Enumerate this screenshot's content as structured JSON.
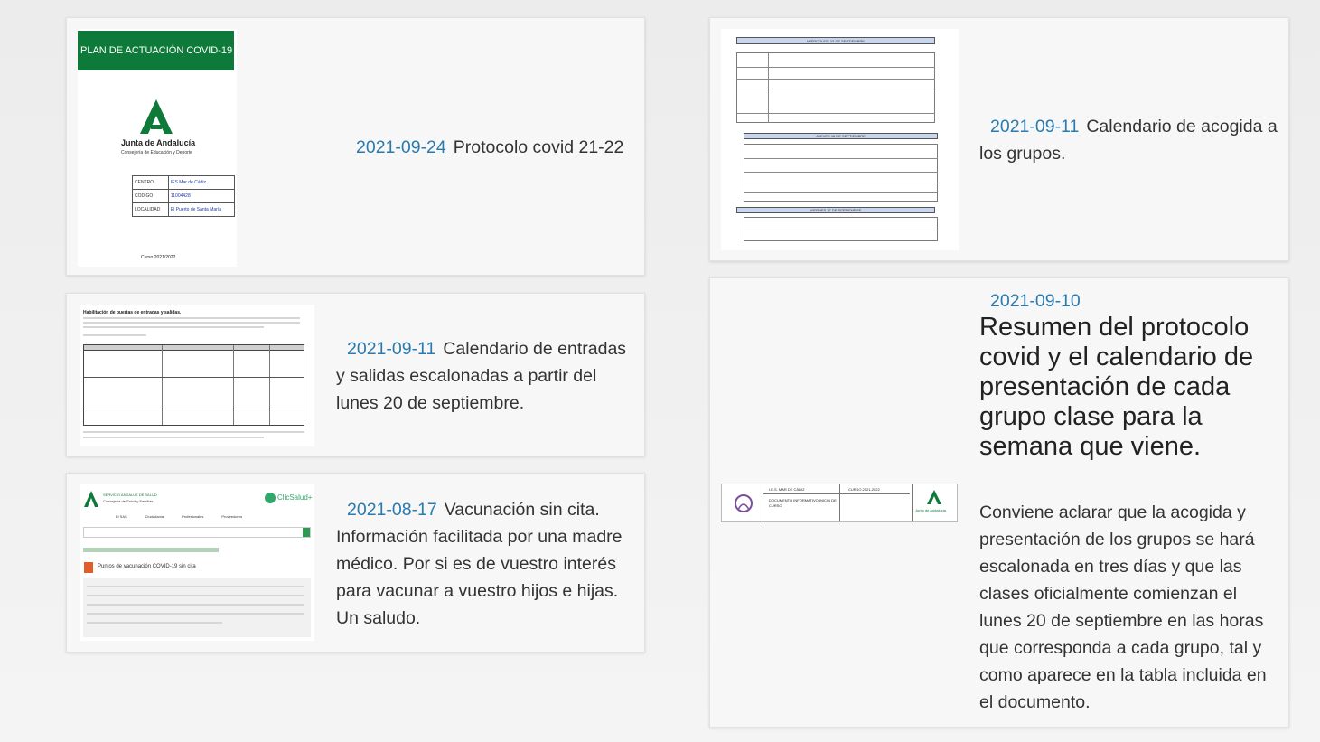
{
  "posts": [
    {
      "date": "2021-09-24",
      "title": "Protocolo covid 21-22",
      "thumb": {
        "header": "PLAN DE ACTUACIÓN COVID-19",
        "org": "Junta de Andalucía",
        "dept": "Consejería de Educación y Deporte",
        "rows": [
          {
            "k": "CENTRO",
            "v": "IES Mar de Cádiz"
          },
          {
            "k": "CÓDIGO",
            "v": "11004428"
          },
          {
            "k": "LOCALIDAD",
            "v": "El Puerto de Santa María"
          }
        ],
        "course": "Curso 2021/2022"
      }
    },
    {
      "date": "2021-09-11",
      "title": "Calendario de entradas y salidas escalonadas a partir del lunes 20 de septiembre.",
      "thumb": {
        "heading": "Habilitación de puertas de entradas y salidas."
      }
    },
    {
      "date": "2021-08-17",
      "title": "Vacunación sin cita. Información facilitada por una madre médico. Por si es de vuestro interés para vacunar a vuestro hijos e hijas. Un saludo.",
      "thumb": {
        "org": "SERVICIO ANDALUZ DE SALUD",
        "dept": "Consejería de Salud y Familias",
        "brand": "ClicSalud+",
        "nav": [
          "El SAS",
          "Ciudadanía",
          "Profesionales",
          "Proveedores"
        ],
        "heading": "Puntos de vacunación COVID-19 sin cita"
      }
    },
    {
      "date": "2021-09-11",
      "title": "Calendario de acogida a los grupos.",
      "thumb": {
        "h1": "MIÉRCOLES, 15 DE SEPTIEMBRE",
        "h2": "JUEVES 16 DE SEPTIEMBRE",
        "h3": "VIERNES 17 DE SEPTIEMBRE"
      }
    },
    {
      "date": "2021-09-10",
      "title": "Resumen del protocolo covid y el calendario de presentación de cada grupo clase para la semana que viene.",
      "body": "Conviene aclarar que la acogida y presentación de los grupos se hará escalonada en tres días y que las clases oficialmente comienzan el lunes 20 de septiembre en las horas que corresponda a cada grupo, tal y como aparece en la tabla incluida en el documento.",
      "thumb": {
        "school": "I.E.S. MAR DE CÁDIZ",
        "course": "CURSO 2021-2022",
        "doc": "DOCUMENTO INFORMATIVO INICIO DE CURSO",
        "org": "Junta de Andalucía"
      }
    }
  ]
}
